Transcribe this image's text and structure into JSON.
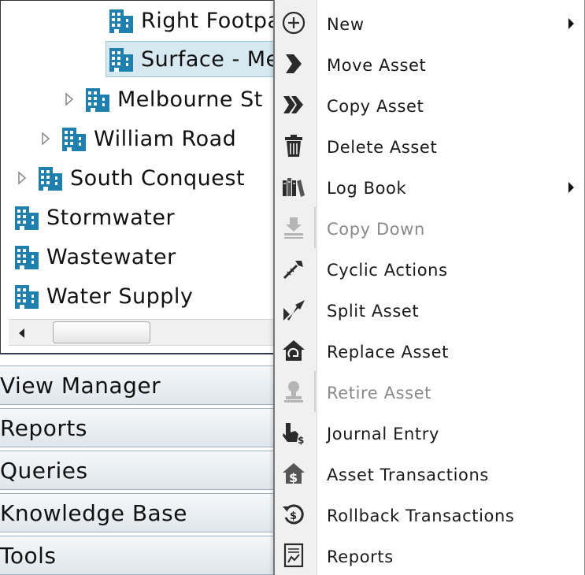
{
  "tree": {
    "rows": [
      {
        "label": "Right Footpath",
        "expandable": false,
        "selected": false
      },
      {
        "label": "Surface - Melbourne St",
        "expandable": false,
        "selected": true
      },
      {
        "label": "Melbourne St",
        "expandable": true,
        "selected": false
      },
      {
        "label": "William Road",
        "expandable": true,
        "selected": false
      },
      {
        "label": "South Conquest",
        "expandable": true,
        "selected": false
      },
      {
        "label": "Stormwater",
        "expandable": false,
        "selected": false
      },
      {
        "label": "Wastewater",
        "expandable": false,
        "selected": false
      },
      {
        "label": "Water Supply",
        "expandable": false,
        "selected": false
      }
    ]
  },
  "nav": {
    "items": [
      {
        "label": "View Manager"
      },
      {
        "label": "Reports"
      },
      {
        "label": "Queries"
      },
      {
        "label": "Knowledge Base"
      },
      {
        "label": "Tools"
      }
    ]
  },
  "context_menu": {
    "items": [
      {
        "label": "New",
        "icon": "plus-circle-icon",
        "submenu": true,
        "enabled": true
      },
      {
        "label": "Move Asset",
        "icon": "move-arrow-icon",
        "submenu": false,
        "enabled": true
      },
      {
        "label": "Copy Asset",
        "icon": "copy-arrows-icon",
        "submenu": false,
        "enabled": true
      },
      {
        "label": "Delete Asset",
        "icon": "trash-icon",
        "submenu": false,
        "enabled": true
      },
      {
        "label": "Log Book",
        "icon": "books-icon",
        "submenu": true,
        "enabled": true
      },
      {
        "label": "Copy Down",
        "icon": "copy-down-icon",
        "submenu": false,
        "enabled": false
      },
      {
        "label": "Cyclic Actions",
        "icon": "wrench-icon",
        "submenu": false,
        "enabled": true
      },
      {
        "label": "Split Asset",
        "icon": "split-icon",
        "submenu": false,
        "enabled": true
      },
      {
        "label": "Replace Asset",
        "icon": "house-replace-icon",
        "submenu": false,
        "enabled": true
      },
      {
        "label": "Retire Asset",
        "icon": "stamp-icon",
        "submenu": false,
        "enabled": false
      },
      {
        "label": "Journal Entry",
        "icon": "hand-dollar-icon",
        "submenu": false,
        "enabled": true
      },
      {
        "label": "Asset Transactions",
        "icon": "house-dollar-icon",
        "submenu": false,
        "enabled": true
      },
      {
        "label": "Rollback Transactions",
        "icon": "rollback-dollar-icon",
        "submenu": false,
        "enabled": true
      },
      {
        "label": "Reports",
        "icon": "report-icon",
        "submenu": false,
        "enabled": true
      }
    ]
  },
  "colors": {
    "building_icon": "#1f7fae",
    "selected_row_bg": "#d6e8f0",
    "disabled_text": "#8a8a8a",
    "icon_dark": "#2b2b2b"
  }
}
